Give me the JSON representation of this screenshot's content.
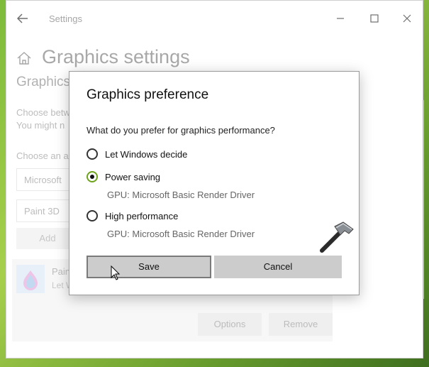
{
  "window": {
    "title": "Settings",
    "page_title": "Graphics settings",
    "section_title": "Graphics",
    "desc_line1": "Choose betw",
    "desc_line2": "You might n",
    "choose_label": "Choose an a",
    "app_type_select": "Microsoft",
    "app_select": "Paint 3D",
    "add_label": "Add",
    "app_item": {
      "name": "Pain",
      "sub": "Let W",
      "icon": "paint-3d-icon"
    },
    "options_label": "Options",
    "remove_label": "Remove"
  },
  "dialog": {
    "title": "Graphics preference",
    "question": "What do you prefer for graphics performance?",
    "options": [
      {
        "label": "Let Windows decide",
        "gpu": "",
        "selected": false
      },
      {
        "label": "Power saving",
        "gpu": "GPU: Microsoft Basic Render Driver",
        "selected": true
      },
      {
        "label": "High performance",
        "gpu": "GPU: Microsoft Basic Render Driver",
        "selected": false
      }
    ],
    "save_label": "Save",
    "cancel_label": "Cancel"
  },
  "colors": {
    "accent": "#6ea31c",
    "desktop": "#7dbb3a"
  }
}
